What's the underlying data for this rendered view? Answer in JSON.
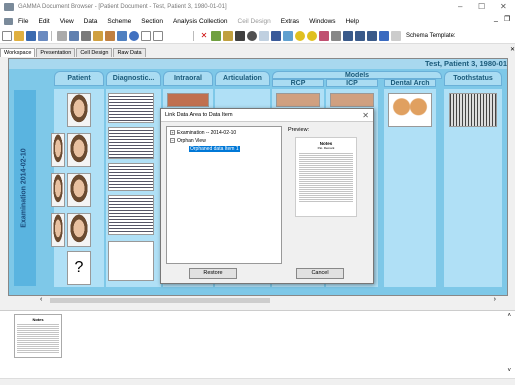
{
  "window": {
    "title": "GAMMA Document Browser - [Patient Document - Test, Patient 3, 1980-01-01]"
  },
  "menu": [
    "File",
    "Edit",
    "View",
    "Data",
    "Scheme",
    "Section",
    "Analysis Collection",
    "Ceil Design",
    "Extras",
    "Windows",
    "Help"
  ],
  "toolbar": {
    "schema_label": "Schema Template:"
  },
  "tabs": [
    "Workspace",
    "Presentation",
    "Cell Design",
    "Raw Data"
  ],
  "workspace": {
    "patient": "Test, Patient 3, 1980-01",
    "exam_label": "Examination 2014-02-10",
    "columns": [
      "Patient",
      "Diagnostic...",
      "Intraoral",
      "Articulation",
      "Models",
      "Dental Arch",
      "Toothstatus"
    ],
    "models_sub": [
      "RCP",
      "ICP"
    ],
    "question_mark": "?"
  },
  "dialog": {
    "title": "Link Data Area to Data Item",
    "preview_label": "Preview:",
    "tree": [
      {
        "label": "Examination -- 2014-02-10",
        "level": 0,
        "toggle": "+"
      },
      {
        "label": "Orphan View",
        "level": 0,
        "toggle": "-"
      },
      {
        "label": "Orphaned data Item 1",
        "level": 1,
        "selected": true
      }
    ],
    "preview_title": "Notes",
    "preview_subtitle": "Pat. Remark",
    "restore_button": "Restore",
    "cancel_button": "Cancel"
  },
  "bottom": {
    "note_title": "Notes"
  },
  "colors": {
    "workspace_bg": "#7ec8e8",
    "header": "#aadcf2",
    "selection": "#0078d7"
  }
}
